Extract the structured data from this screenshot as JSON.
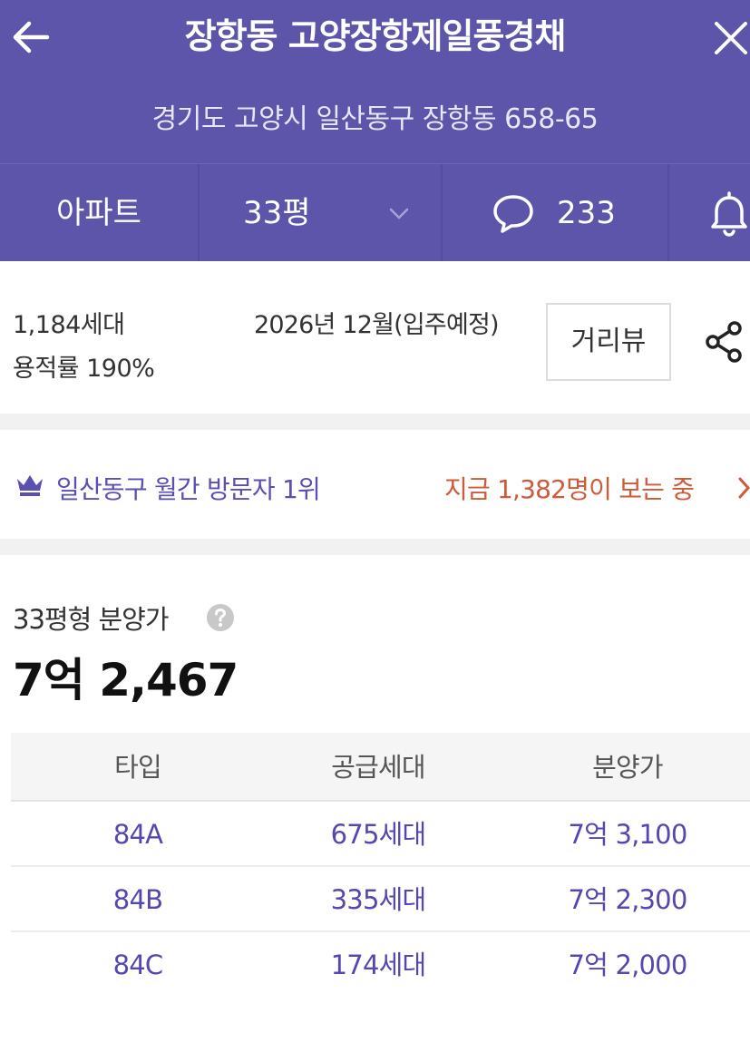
{
  "header": {
    "title": "장항동 고양장항제일풍경채",
    "address": "경기도 고양시 일산동구 장항동 658-65",
    "back_icon": "arrow-left-icon",
    "close_icon": "close-icon",
    "background_color": "#5d55a9"
  },
  "tabs": {
    "type_label": "아파트",
    "size_label": "33평",
    "comment_count": "233",
    "comment_icon": "speech-bubble-icon",
    "notify_icon": "bell-icon"
  },
  "info": {
    "households": "1,184세대",
    "floor_area_ratio": "용적률 190%",
    "move_in": "2026년 12월(입주예정)",
    "street_view_label": "거리뷰",
    "share_icon": "share-icon"
  },
  "visitors": {
    "rank_text": "일산동구 월간 방문자 1위",
    "viewers_text": "지금 1,382명이 보는 중",
    "rank_color": "#5a4fb3",
    "viewers_color": "#cf5a3a"
  },
  "price": {
    "label": "33평형 분양가",
    "value": "7억 2,467",
    "table": {
      "headers": [
        "타입",
        "공급세대",
        "분양가"
      ],
      "rows": [
        {
          "type": "84A",
          "units": "675세대",
          "price": "7억 3,100"
        },
        {
          "type": "84B",
          "units": "335세대",
          "price": "7억 2,300"
        },
        {
          "type": "84C",
          "units": "174세대",
          "price": "7억 2,000"
        }
      ]
    }
  }
}
